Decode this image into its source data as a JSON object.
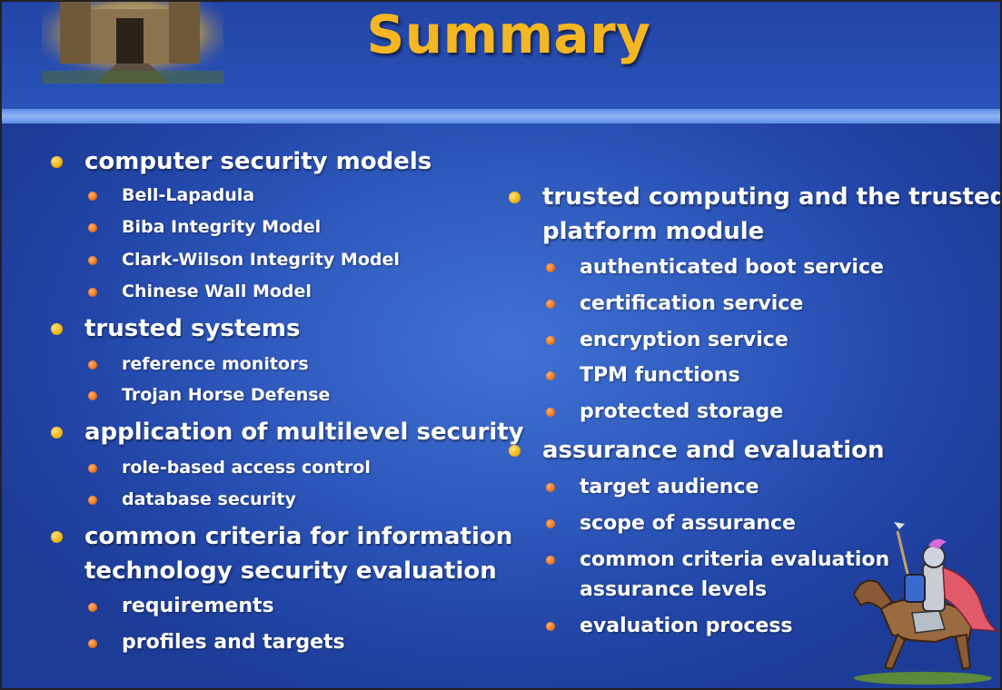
{
  "slide": {
    "title": "Summary",
    "left_column": [
      {
        "label": "computer security models",
        "items": [
          "Bell-Lapadula",
          "Biba Integrity Model",
          "Clark-Wilson Integrity Model",
          "Chinese Wall Model"
        ]
      },
      {
        "label": "trusted systems",
        "items": [
          "reference monitors",
          "Trojan Horse Defense"
        ]
      },
      {
        "label": "application of multilevel security",
        "items": [
          "role-based access control",
          "database security"
        ]
      },
      {
        "label_line1": "common criteria for information",
        "label_line2": "technology security evaluation",
        "items": [
          "requirements",
          "profiles and targets"
        ]
      }
    ],
    "right_column": [
      {
        "label_line1": "trusted computing and the trusted",
        "label_line2": "platform module",
        "items": [
          "authenticated boot service",
          "certification service",
          "encryption service",
          "TPM functions",
          "protected storage"
        ]
      },
      {
        "label": "assurance and evaluation",
        "items": [
          "target audience",
          "scope of assurance"
        ],
        "item3_line1": "common criteria evaluation",
        "item3_line2": "assurance levels",
        "item4": "evaluation process"
      }
    ],
    "colors": {
      "title": "#f4b622",
      "background": "#2f59bd",
      "bullet_l1": "#f2b510",
      "bullet_l2": "#f0761e"
    }
  }
}
